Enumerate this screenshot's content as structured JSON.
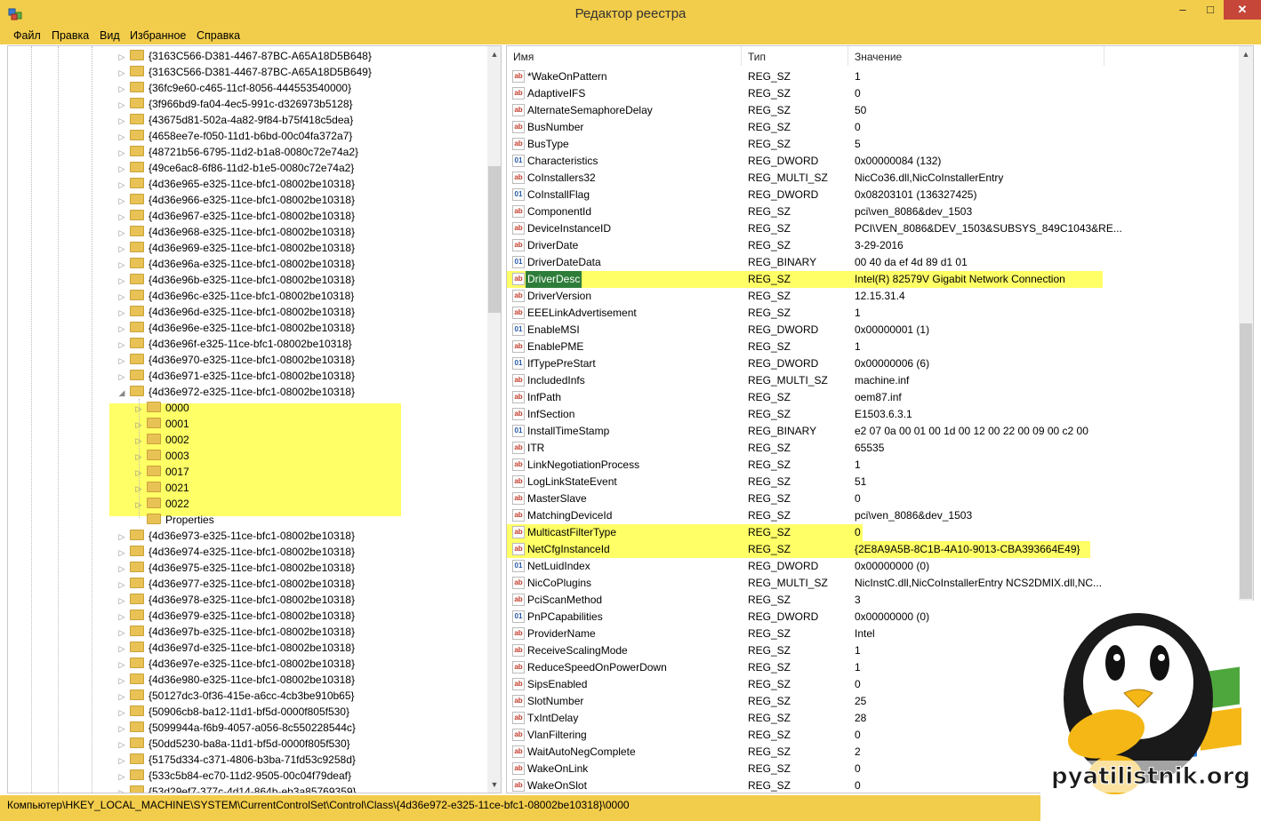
{
  "window": {
    "title": "Редактор реестра"
  },
  "menu": [
    "Файл",
    "Правка",
    "Вид",
    "Избранное",
    "Справка"
  ],
  "tree": {
    "items_before": [
      "{3163C566-D381-4467-87BC-A65A18D5B648}",
      "{3163C566-D381-4467-87BC-A65A18D5B649}",
      "{36fc9e60-c465-11cf-8056-444553540000}",
      "{3f966bd9-fa04-4ec5-991c-d326973b5128}",
      "{43675d81-502a-4a82-9f84-b75f418c5dea}",
      "{4658ee7e-f050-11d1-b6bd-00c04fa372a7}",
      "{48721b56-6795-11d2-b1a8-0080c72e74a2}",
      "{49ce6ac8-6f86-11d2-b1e5-0080c72e74a2}",
      "{4d36e965-e325-11ce-bfc1-08002be10318}",
      "{4d36e966-e325-11ce-bfc1-08002be10318}",
      "{4d36e967-e325-11ce-bfc1-08002be10318}",
      "{4d36e968-e325-11ce-bfc1-08002be10318}",
      "{4d36e969-e325-11ce-bfc1-08002be10318}",
      "{4d36e96a-e325-11ce-bfc1-08002be10318}",
      "{4d36e96b-e325-11ce-bfc1-08002be10318}",
      "{4d36e96c-e325-11ce-bfc1-08002be10318}",
      "{4d36e96d-e325-11ce-bfc1-08002be10318}",
      "{4d36e96e-e325-11ce-bfc1-08002be10318}",
      "{4d36e96f-e325-11ce-bfc1-08002be10318}",
      "{4d36e970-e325-11ce-bfc1-08002be10318}",
      "{4d36e971-e325-11ce-bfc1-08002be10318}"
    ],
    "expanded": "{4d36e972-e325-11ce-bfc1-08002be10318}",
    "children": [
      "0000",
      "0001",
      "0002",
      "0003",
      "0017",
      "0021",
      "0022",
      "Properties"
    ],
    "items_after": [
      "{4d36e973-e325-11ce-bfc1-08002be10318}",
      "{4d36e974-e325-11ce-bfc1-08002be10318}",
      "{4d36e975-e325-11ce-bfc1-08002be10318}",
      "{4d36e977-e325-11ce-bfc1-08002be10318}",
      "{4d36e978-e325-11ce-bfc1-08002be10318}",
      "{4d36e979-e325-11ce-bfc1-08002be10318}",
      "{4d36e97b-e325-11ce-bfc1-08002be10318}",
      "{4d36e97d-e325-11ce-bfc1-08002be10318}",
      "{4d36e97e-e325-11ce-bfc1-08002be10318}",
      "{4d36e980-e325-11ce-bfc1-08002be10318}",
      "{50127dc3-0f36-415e-a6cc-4cb3be910b65}",
      "{50906cb8-ba12-11d1-bf5d-0000f805f530}",
      "{5099944a-f6b9-4057-a056-8c550228544c}",
      "{50dd5230-ba8a-11d1-bf5d-0000f805f530}",
      "{5175d334-c371-4806-b3ba-71fd53c9258d}",
      "{533c5b84-ec70-11d2-9505-00c04f79deaf}",
      "{53d29ef7-377c-4d14-864b-eb3a85769359}"
    ]
  },
  "columns": {
    "name": "Имя",
    "type": "Тип",
    "value": "Значение"
  },
  "values": [
    {
      "name": "*WakeOnPattern",
      "type": "REG_SZ",
      "value": "1",
      "icon": "string-value-icon"
    },
    {
      "name": "AdaptiveIFS",
      "type": "REG_SZ",
      "value": "0",
      "icon": "string-value-icon"
    },
    {
      "name": "AlternateSemaphoreDelay",
      "type": "REG_SZ",
      "value": "50",
      "icon": "string-value-icon"
    },
    {
      "name": "BusNumber",
      "type": "REG_SZ",
      "value": "0",
      "icon": "string-value-icon"
    },
    {
      "name": "BusType",
      "type": "REG_SZ",
      "value": "5",
      "icon": "string-value-icon"
    },
    {
      "name": "Characteristics",
      "type": "REG_DWORD",
      "value": "0x00000084 (132)",
      "icon": "binary-value-icon"
    },
    {
      "name": "CoInstallers32",
      "type": "REG_MULTI_SZ",
      "value": "NicCo36.dll,NicCoInstallerEntry",
      "icon": "string-value-icon"
    },
    {
      "name": "CoInstallFlag",
      "type": "REG_DWORD",
      "value": "0x08203101 (136327425)",
      "icon": "binary-value-icon"
    },
    {
      "name": "ComponentId",
      "type": "REG_SZ",
      "value": "pci\\ven_8086&dev_1503",
      "icon": "string-value-icon"
    },
    {
      "name": "DeviceInstanceID",
      "type": "REG_SZ",
      "value": "PCI\\VEN_8086&DEV_1503&SUBSYS_849C1043&RE...",
      "icon": "string-value-icon"
    },
    {
      "name": "DriverDate",
      "type": "REG_SZ",
      "value": "3-29-2016",
      "icon": "string-value-icon"
    },
    {
      "name": "DriverDateData",
      "type": "REG_BINARY",
      "value": "00 40 da ef 4d 89 d1 01",
      "icon": "binary-value-icon"
    },
    {
      "name": "DriverDesc",
      "type": "REG_SZ",
      "value": "Intel(R) 82579V Gigabit Network Connection",
      "icon": "string-value-icon"
    },
    {
      "name": "DriverVersion",
      "type": "REG_SZ",
      "value": "12.15.31.4",
      "icon": "string-value-icon"
    },
    {
      "name": "EEELinkAdvertisement",
      "type": "REG_SZ",
      "value": "1",
      "icon": "string-value-icon"
    },
    {
      "name": "EnableMSI",
      "type": "REG_DWORD",
      "value": "0x00000001 (1)",
      "icon": "binary-value-icon"
    },
    {
      "name": "EnablePME",
      "type": "REG_SZ",
      "value": "1",
      "icon": "string-value-icon"
    },
    {
      "name": "IfTypePreStart",
      "type": "REG_DWORD",
      "value": "0x00000006 (6)",
      "icon": "binary-value-icon"
    },
    {
      "name": "IncludedInfs",
      "type": "REG_MULTI_SZ",
      "value": "machine.inf",
      "icon": "string-value-icon"
    },
    {
      "name": "InfPath",
      "type": "REG_SZ",
      "value": "oem87.inf",
      "icon": "string-value-icon"
    },
    {
      "name": "InfSection",
      "type": "REG_SZ",
      "value": "E1503.6.3.1",
      "icon": "string-value-icon"
    },
    {
      "name": "InstallTimeStamp",
      "type": "REG_BINARY",
      "value": "e2 07 0a 00 01 00 1d 00 12 00 22 00 09 00 c2 00",
      "icon": "binary-value-icon"
    },
    {
      "name": "ITR",
      "type": "REG_SZ",
      "value": "65535",
      "icon": "string-value-icon"
    },
    {
      "name": "LinkNegotiationProcess",
      "type": "REG_SZ",
      "value": "1",
      "icon": "string-value-icon"
    },
    {
      "name": "LogLinkStateEvent",
      "type": "REG_SZ",
      "value": "51",
      "icon": "string-value-icon"
    },
    {
      "name": "MasterSlave",
      "type": "REG_SZ",
      "value": "0",
      "icon": "string-value-icon"
    },
    {
      "name": "MatchingDeviceId",
      "type": "REG_SZ",
      "value": "pci\\ven_8086&dev_1503",
      "icon": "string-value-icon"
    },
    {
      "name": "MulticastFilterType",
      "type": "REG_SZ",
      "value": "0",
      "icon": "string-value-icon"
    },
    {
      "name": "NetCfgInstanceId",
      "type": "REG_SZ",
      "value": "{2E8A9A5B-8C1B-4A10-9013-CBA393664E49}",
      "icon": "string-value-icon"
    },
    {
      "name": "NetLuidIndex",
      "type": "REG_DWORD",
      "value": "0x00000000 (0)",
      "icon": "binary-value-icon"
    },
    {
      "name": "NicCoPlugins",
      "type": "REG_MULTI_SZ",
      "value": "NicInstC.dll,NicCoInstallerEntry NCS2DMIX.dll,NC...",
      "icon": "string-value-icon"
    },
    {
      "name": "PciScanMethod",
      "type": "REG_SZ",
      "value": "3",
      "icon": "string-value-icon"
    },
    {
      "name": "PnPCapabilities",
      "type": "REG_DWORD",
      "value": "0x00000000 (0)",
      "icon": "binary-value-icon"
    },
    {
      "name": "ProviderName",
      "type": "REG_SZ",
      "value": "Intel",
      "icon": "string-value-icon"
    },
    {
      "name": "ReceiveScalingMode",
      "type": "REG_SZ",
      "value": "1",
      "icon": "string-value-icon"
    },
    {
      "name": "ReduceSpeedOnPowerDown",
      "type": "REG_SZ",
      "value": "1",
      "icon": "string-value-icon"
    },
    {
      "name": "SipsEnabled",
      "type": "REG_SZ",
      "value": "0",
      "icon": "string-value-icon"
    },
    {
      "name": "SlotNumber",
      "type": "REG_SZ",
      "value": "25",
      "icon": "string-value-icon"
    },
    {
      "name": "TxIntDelay",
      "type": "REG_SZ",
      "value": "28",
      "icon": "string-value-icon"
    },
    {
      "name": "VlanFiltering",
      "type": "REG_SZ",
      "value": "0",
      "icon": "string-value-icon"
    },
    {
      "name": "WaitAutoNegComplete",
      "type": "REG_SZ",
      "value": "2",
      "icon": "string-value-icon"
    },
    {
      "name": "WakeOnLink",
      "type": "REG_SZ",
      "value": "0",
      "icon": "string-value-icon"
    },
    {
      "name": "WakeOnSlot",
      "type": "REG_SZ",
      "value": "0",
      "icon": "string-value-icon"
    }
  ],
  "selected_value": "DriverDesc",
  "highlighted_values": [
    "DriverDesc",
    "MulticastFilterType",
    "NetCfgInstanceId"
  ],
  "status": {
    "path": "Компьютер\\HKEY_LOCAL_MACHINE\\SYSTEM\\CurrentControlSet\\Control\\Class\\{4d36e972-e325-11ce-bfc1-08002be10318}\\0000"
  },
  "watermark": {
    "text": "pyatilistnik.org"
  },
  "colors": {
    "chrome": "#f2cc4b",
    "highlight": "#ffff66",
    "selection": "#2d7d39",
    "close": "#c7463a"
  }
}
